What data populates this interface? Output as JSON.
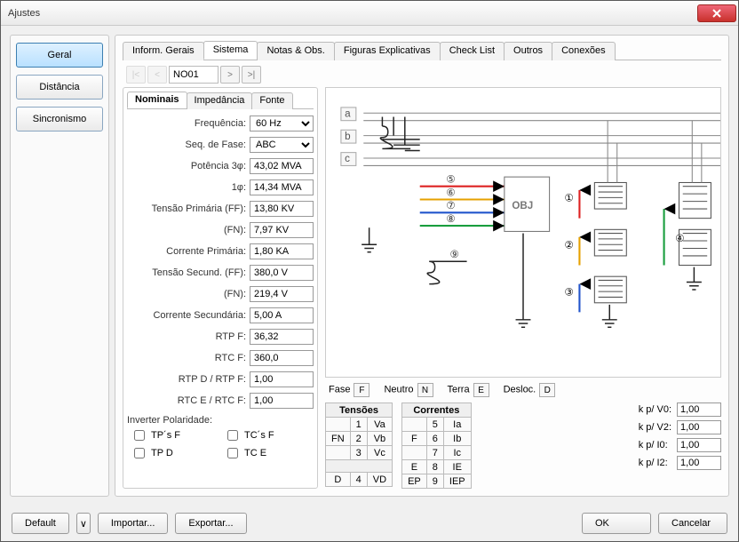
{
  "window": {
    "title": "Ajustes"
  },
  "sidebar": {
    "items": [
      {
        "label": "Geral",
        "active": true
      },
      {
        "label": "Distância"
      },
      {
        "label": "Sincronismo"
      }
    ]
  },
  "tabs": {
    "items": [
      {
        "label": "Inform. Gerais"
      },
      {
        "label": "Sistema",
        "active": true
      },
      {
        "label": "Notas & Obs."
      },
      {
        "label": "Figuras Explicativas"
      },
      {
        "label": "Check List"
      },
      {
        "label": "Outros"
      },
      {
        "label": "Conexões"
      }
    ]
  },
  "nav": {
    "first": "|<",
    "prev": "<",
    "node": "NO01",
    "next": ">",
    "last": ">|"
  },
  "subtabs": {
    "items": [
      {
        "label": "Nominais",
        "active": true
      },
      {
        "label": "Impedância"
      },
      {
        "label": "Fonte"
      }
    ]
  },
  "form": {
    "frequencia": {
      "label": "Frequência:",
      "value": "60 Hz"
    },
    "seqfase": {
      "label": "Seq. de Fase:",
      "value": "ABC"
    },
    "pot3": {
      "label": "Potência 3φ:",
      "value": "43,02 MVA"
    },
    "pot1": {
      "label": "1φ:",
      "value": "14,34 MVA"
    },
    "tensaoPrimFF": {
      "label": "Tensão Primária (FF):",
      "value": "13,80 KV"
    },
    "tensaoPrimFN": {
      "label": "(FN):",
      "value": "7,97 KV"
    },
    "corrPrim": {
      "label": "Corrente Primária:",
      "value": "1,80 KA"
    },
    "tensaoSecFF": {
      "label": "Tensão Secund. (FF):",
      "value": "380,0 V"
    },
    "tensaoSecFN": {
      "label": "(FN):",
      "value": "219,4 V"
    },
    "corrSec": {
      "label": "Corrente Secundária:",
      "value": "5,00 A"
    },
    "rtpf": {
      "label": "RTP F:",
      "value": "36,32"
    },
    "rtcf": {
      "label": "RTC F:",
      "value": "360,0"
    },
    "rtpd": {
      "label": "RTP D / RTP F:",
      "value": "1,00"
    },
    "rtce": {
      "label": "RTC E / RTC F:",
      "value": "1,00"
    }
  },
  "invert": {
    "title": "Inverter Polaridade:",
    "tpsf": "TP´s F",
    "tcsf": "TC´s F",
    "tpd": "TP D",
    "tce": "TC E"
  },
  "legend": {
    "fase": "Fase",
    "f": "F",
    "neutro": "Neutro",
    "n": "N",
    "terra": "Terra",
    "e": "E",
    "desloc": "Desloc.",
    "d": "D"
  },
  "tensoes": {
    "title": "Tensões",
    "rows": [
      [
        "",
        "1",
        "Va"
      ],
      [
        "FN",
        "2",
        "Vb"
      ],
      [
        "",
        "3",
        "Vc"
      ],
      [
        "",
        "",
        ""
      ],
      [
        "D",
        "4",
        "VD"
      ]
    ]
  },
  "correntes": {
    "title": "Correntes",
    "rows": [
      [
        "",
        "5",
        "Ia"
      ],
      [
        "F",
        "6",
        "Ib"
      ],
      [
        "",
        "7",
        "Ic"
      ],
      [
        "E",
        "8",
        "IE"
      ],
      [
        "EP",
        "9",
        "IEP"
      ]
    ]
  },
  "kfields": {
    "v0": {
      "label": "k p/ V0:",
      "value": "1,00"
    },
    "v2": {
      "label": "k p/ V2:",
      "value": "1,00"
    },
    "i0": {
      "label": "k p/ I0:",
      "value": "1,00"
    },
    "i2": {
      "label": "k p/ I2:",
      "value": "1,00"
    }
  },
  "diagram": {
    "abc": [
      "a",
      "b",
      "c"
    ],
    "obj": "OBJ",
    "nums": [
      "⑤",
      "⑥",
      "⑦",
      "⑧",
      "⑨",
      "①",
      "②",
      "③",
      "④"
    ]
  },
  "footer": {
    "default": "Default",
    "importar": "Importar...",
    "exportar": "Exportar...",
    "ok": "OK",
    "cancelar": "Cancelar",
    "caret": "∨"
  }
}
